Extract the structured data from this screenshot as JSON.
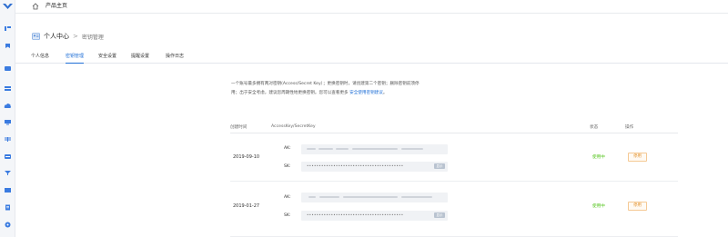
{
  "header": {
    "title": "产品主页"
  },
  "breadcrumb": {
    "root": "个人中心",
    "separator": ">",
    "current": "密钥管理"
  },
  "tabs": [
    {
      "label": "个人信息",
      "active": false
    },
    {
      "label": "密钥管理",
      "active": true
    },
    {
      "label": "安全设置",
      "active": false
    },
    {
      "label": "提醒设置",
      "active": false
    },
    {
      "label": "操作日志",
      "active": false
    }
  ],
  "notice": {
    "line1": "一个账号最多拥有两对密钥(Access/Secret Key）；更换密钥时，请创建第二个密钥；删除密钥前须停",
    "line2_prefix": "用；出于安全考虑，建议您周期性地更换密钥。您可以查看更多 ",
    "link": "安全使用密钥建议",
    "line2_suffix": "。"
  },
  "table": {
    "columns": {
      "created": "创建时间",
      "keys": "AccessKey/SecretKey",
      "status": "状态",
      "action": "操作"
    },
    "ak_label": "AK:",
    "sk_label": "SK:",
    "sk_mask": "••••••••••••••••••••••••••••••••••••••••",
    "show_label": "显示",
    "rows": [
      {
        "date": "2019-09-10",
        "status": "使用中",
        "action": "停用"
      },
      {
        "date": "2019-01-27",
        "status": "使用中",
        "action": "停用"
      }
    ]
  },
  "colors": {
    "accent": "#1f6fd6",
    "status_active": "#52c41a",
    "action": "#e08a1e"
  },
  "icons": [
    "app-logo-icon",
    "home-icon",
    "profile-card-icon",
    "sidebar-nav-icons"
  ]
}
